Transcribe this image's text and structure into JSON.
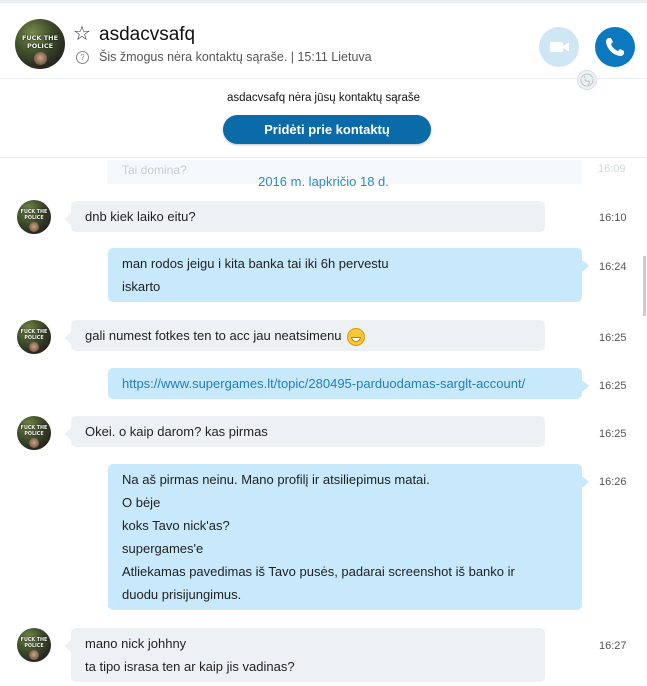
{
  "header": {
    "contact_name": "asdacvsafq",
    "status": "Šis žmogus nėra kontaktų sąraše.  |  15:11 Lietuva",
    "avatar_text": [
      "FUCK THE",
      "POLICE"
    ],
    "accent": "#0b78bf",
    "video_icon": "video-camera-icon",
    "call_icon": "phone-icon"
  },
  "notice": {
    "text": "asdacvsafq nėra jūsų kontaktų sąraše",
    "button_label": "Pridėti prie kontaktų"
  },
  "ghost": {
    "text": "Tai domina?",
    "time": "16:09"
  },
  "date_separator": "2016 m. lapkričio 18 d.",
  "messages": [
    {
      "dir": "in",
      "lines": [
        "dnb kiek laiko eitu?"
      ],
      "time": "16:10"
    },
    {
      "dir": "out",
      "lines": [
        "man rodos jeigu i kita banka tai iki 6h pervestu",
        "iskarto"
      ],
      "time": "16:24"
    },
    {
      "dir": "in",
      "lines": [
        "gali numest fotkes ten to acc jau neatsimenu"
      ],
      "emoji": "grinning-face-icon",
      "time": "16:25"
    },
    {
      "dir": "out",
      "lines": [
        "https://www.supergames.lt/topic/280495-parduodamas-sarglt-account/"
      ],
      "time": "16:25"
    },
    {
      "dir": "in",
      "lines": [
        "Okei. o kaip darom? kas pirmas"
      ],
      "time": "16:25"
    },
    {
      "dir": "out",
      "lines": [
        "Na aš pirmas neinu. Mano profilį ir atsiliepimus matai.",
        "O bėje",
        "koks Tavo nick'as?",
        "supergames'e",
        "Atliekamas pavedimas iš Tavo pusės, padarai screenshot iš banko ir",
        "duodu prisijungimus."
      ],
      "time": "16:26"
    },
    {
      "dir": "in",
      "lines": [
        "mano nick johhny",
        "ta tipo israsa ten ar kaip jis vadinas?"
      ],
      "time": "16:27"
    }
  ]
}
